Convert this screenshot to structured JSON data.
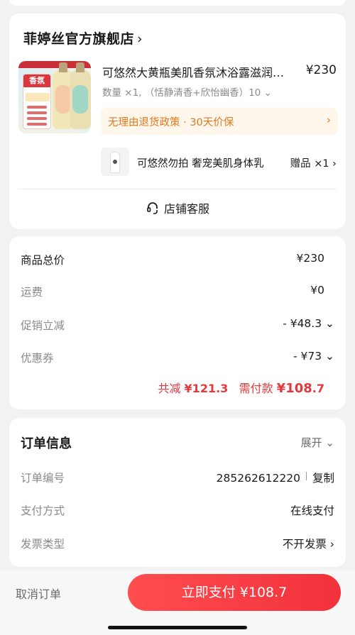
{
  "shop": {
    "name": "菲婷丝官方旗舰店",
    "chevron": "›",
    "product": {
      "image_tag": "香氛",
      "title": "可悠然大黄瓶美肌香氛沐浴露滋润留香",
      "price": "¥230",
      "spec": "数量 ×1, （恬静清香+欣怡幽香）10 ⌄"
    },
    "policy": {
      "text": "无理由退货政策 · 30天价保",
      "chevron": "›"
    },
    "gift": {
      "name": "可悠然勿拍 奢宠美肌身体乳",
      "tag": "赠品 ×1 ›"
    },
    "service": "店铺客服"
  },
  "price_detail": {
    "rows": [
      {
        "label": "商品总价",
        "value": "¥230"
      },
      {
        "label": "运费",
        "value": "¥0"
      },
      {
        "label": "促销立减",
        "value": "- ¥48.3 ⌄"
      },
      {
        "label": "优惠券",
        "value": "- ¥73 ⌄"
      }
    ],
    "summary": {
      "total_reduce_label": "共减",
      "total_reduce": "¥121.3",
      "pay_label": "需付款",
      "pay_amount_int": "¥108",
      "pay_amount_dec": ".7"
    }
  },
  "order_info": {
    "title": "订单信息",
    "expand": "展开 ⌄",
    "rows": [
      {
        "label": "订单编号",
        "value": "285262612220",
        "action": "复制"
      },
      {
        "label": "支付方式",
        "value": "在线支付"
      },
      {
        "label": "发票类型",
        "value": "不开发票 ›"
      }
    ]
  },
  "bottom_bar": {
    "cancel": "取消订单",
    "pay_button": "立即支付 ¥108.7"
  },
  "colors": {
    "accent_red": "#e4393c",
    "pay_button": "#f2313b",
    "policy_orange": "#e07a1f"
  }
}
